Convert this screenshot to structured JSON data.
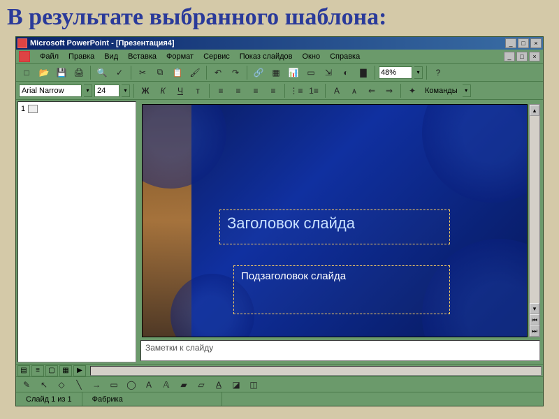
{
  "page": {
    "heading": "В результате выбранного шаблона:"
  },
  "titlebar": {
    "app_name": "Microsoft PowerPoint",
    "doc_name": "[Презентация4]",
    "full_title": "Microsoft PowerPoint - [Презентация4]",
    "min": "_",
    "max": "□",
    "close": "×"
  },
  "menu": {
    "file": "Файл",
    "edit": "Правка",
    "view": "Вид",
    "insert": "Вставка",
    "format": "Формат",
    "tools": "Сервис",
    "slideshow": "Показ слайдов",
    "window": "Окно",
    "help": "Справка"
  },
  "toolbar1": {
    "new": "□",
    "open": "📂",
    "save": "💾",
    "print": "🖨",
    "preview": "🔍",
    "spell": "✓",
    "cut": "✂",
    "copy": "⧉",
    "paste": "📋",
    "fmtpaint": "🖌",
    "undo": "↶",
    "redo": "↷",
    "link": "🔗",
    "table": "▦",
    "chart": "📊",
    "newslide": "▭",
    "expand": "⇲",
    "grayscale": "◐",
    "color": "▇",
    "zoom_value": "48%",
    "help": "?"
  },
  "toolbar2": {
    "font_name": "Arial Narrow",
    "font_size": "24",
    "bold": "Ж",
    "italic": "К",
    "underline": "Ч",
    "shadow": "т",
    "al": "≡",
    "ac": "≡",
    "ar": "≡",
    "aj": "≡",
    "bullets": "⋮≡",
    "numbering": "1≡",
    "inc": "A",
    "dec": "ᴀ",
    "promote": "⇐",
    "demote": "⇒",
    "effects": "✦",
    "commands_label": "Команды",
    "arrow": "▾"
  },
  "outline": {
    "slide1_num": "1"
  },
  "slide": {
    "title_placeholder": "Заголовок слайда",
    "subtitle_placeholder": "Подзаголовок слайда"
  },
  "notes": {
    "placeholder": "Заметки к слайду"
  },
  "status": {
    "slide_counter": "Слайд 1 из 1",
    "template_name": "Фабрика"
  },
  "scroll": {
    "up": "▴",
    "down": "▾",
    "prev": "⏮",
    "next": "⏭"
  }
}
